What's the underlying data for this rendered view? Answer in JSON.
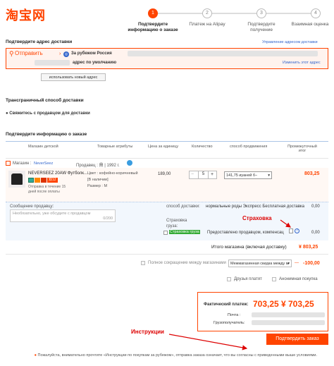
{
  "logo": "淘宝网",
  "steps": [
    {
      "num": "1",
      "label": "Подтвердите информацию о заказе",
      "active": true
    },
    {
      "num": "2",
      "label": "Платеж на Alipay",
      "active": false
    },
    {
      "num": "3",
      "label": "Подтвердите получение",
      "active": false
    },
    {
      "num": "4",
      "label": "Взаимная оценка",
      "active": false
    }
  ],
  "address": {
    "section_title": "Подтвердите адрес доставки",
    "manage_link": "Управление адресом доставки",
    "send_label": "Отправить",
    "abroad_label": "За рубежом Россия",
    "default_label": "адрес по умолчанию",
    "edit_link": "Изменить этот адрес",
    "new_address_button": "использовать новый адрес"
  },
  "shipping": {
    "title": "Трансграничный способ доставки",
    "contact": "Свяжитесь с продавцом для доставки"
  },
  "order": {
    "title": "Подтвердите информацию о заказе",
    "columns": [
      "Магазин детской",
      "Товарные атрибуты",
      "Цена за единицу",
      "Количество",
      "способ продвижения",
      "Промежуточный итог"
    ],
    "shop_label": "Магазин :",
    "shop_name": "NeverSeez",
    "seller_label": "Продавец : 鼎 | 1992 г.",
    "product_name": "NEVERSEEZ 20AW Футболк...",
    "product_badge": "双12",
    "product_note": "Отправка в течение 15 дней после оплаты",
    "attr_color": "Цвет : кофейно-коричневый",
    "attr_stock": "[В наличии]",
    "attr_size": "Размер : M",
    "unit_price": "189,00",
    "qty_minus": "−",
    "qty": "5",
    "qty_plus": "+",
    "promo": "141,75 иуаней б−",
    "subtotal": "803,25",
    "message_label": "Сообщение продавцу:",
    "message_placeholder": "Необязательно, уже обсудите с продавцом",
    "message_count": "0/200",
    "delivery_label": "способ доставки:",
    "delivery_value": "нормальные роды Экспресс Бесплатная доставка",
    "delivery_price": "0,00",
    "insurance_label": "Страховка груза:",
    "insurance_tag": "Страховка груза",
    "insurance_value": "Предоставлено продавцом, компенсац",
    "insurance_price": "0,00",
    "store_total_label": "Итого магазина (включая доставку)",
    "store_total": "¥ 803,25"
  },
  "discount": {
    "label": "Полное сокращение между магазинами",
    "select": "Межмагазинная скидка между м",
    "value": "-100,00"
  },
  "friends_pay": "Друзья платят",
  "anonymous": "Анонимная покупка",
  "payment": {
    "label": "Фактический платеж:",
    "amount1": "703,25",
    "amount2": "¥ 703,25",
    "mail_label": "Почта :",
    "recipient_label": "Грузополучатель:"
  },
  "submit": "Подтвердить заказ",
  "footer": "Пожалуйста, внимательно прочтите «Инструкции по покупкам за рубежом», отправка заказа означает, что вы согласны с приведенными выше условиями.",
  "annotations": {
    "insurance": "Страховка",
    "instructions": "Инструкции"
  },
  "colors": {
    "accent": "#ff4400",
    "annotation": "#dd0000",
    "link": "#3366cc"
  }
}
